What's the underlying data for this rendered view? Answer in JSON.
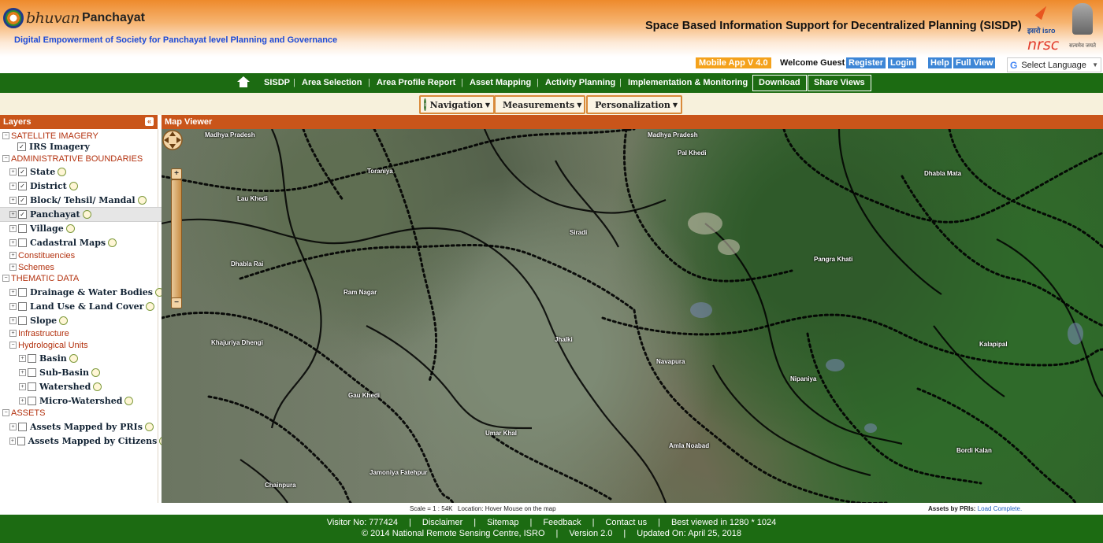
{
  "header": {
    "logo_word": "bhuvan",
    "logo_sub": "Panchayat",
    "tagline": "Digital Empowerment of Society for Panchayat level Planning and Governance",
    "title": "Space Based Information Support for Decentralized Planning (SISDP)",
    "isro_label": "इसरो isro",
    "nrsc_label": "nrsc",
    "emblem_text": "सत्यमेव जयते"
  },
  "topbar": {
    "mobile_app": "Mobile App V 4.0",
    "welcome": "Welcome Guest",
    "register": "Register",
    "login": "Login",
    "help": "Help",
    "full_view": "Full View",
    "language": "Select Language"
  },
  "nav": {
    "items": [
      "SISDP",
      "Area Selection",
      "Area Profile Report",
      "Asset Mapping",
      "Activity Planning",
      "Implementation & Monitoring"
    ],
    "download": "Download",
    "share_views": "Share Views"
  },
  "toolbar": {
    "navigation": "Navigation",
    "measurements": "Measurements",
    "personalization": "Personalization"
  },
  "layers": {
    "title": "Layers",
    "rows": {
      "satellite": "SATELLITE IMAGERY",
      "irs": "IRS Imagery",
      "admin": "ADMINISTRATIVE BOUNDARIES",
      "state": "State",
      "district": "District",
      "block": "Block/ Tehsil/ Mandal",
      "panchayat": "Panchayat",
      "village": "Village",
      "cadastral": "Cadastral Maps",
      "constituencies": "Constituencies",
      "schemes": "Schemes",
      "thematic": "THEMATIC DATA",
      "drainage": "Drainage & Water Bodies",
      "landuse": "Land Use & Land Cover",
      "slope": "Slope",
      "infrastructure": "Infrastructure",
      "hydro": "Hydrological Units",
      "basin": "Basin",
      "subbasin": "Sub-Basin",
      "watershed": "Watershed",
      "microwatershed": "Micro-Watershed",
      "assets": "ASSETS",
      "assets_pri": "Assets Mapped by PRIs",
      "assets_citizens": "Assets Mapped by Citizens"
    }
  },
  "map": {
    "title": "Map Viewer",
    "places": {
      "madhya1": "Madhya Pradesh",
      "madhya2": "Madhya Pradesh",
      "pal_khedi": "Pal Khedi",
      "toraniya": "Toraniya",
      "dhabla_mata": "Dhabla Mata",
      "lau_khedi": "Lau Khedi",
      "siradi": "Siradi",
      "pangra_khati": "Pangra Khati",
      "dhabla_rai": "Dhabla Rai",
      "ram_nagar": "Ram Nagar",
      "khajuriya": "Khajuriya Dhengi",
      "jhalki": "Jhalki",
      "kalapipal": "Kalapipal",
      "navapura": "Navapura",
      "nipaniya": "Nipaniya",
      "gau_khedi": "Gau Khedi",
      "umar_khal": "Umar Khal",
      "amla_noabad": "Amla Noabad",
      "bordi_kalan": "Bordi Kalan",
      "chainpura": "Chainpura",
      "jamoniya": "Jamoniya Fatehpur"
    }
  },
  "status": {
    "scale": "Scale = 1 : 54K",
    "location": "Location: Hover Mouse on the map",
    "assets_label": "Assets by PRIs:",
    "assets_value": "Load Complete."
  },
  "footer": {
    "visitor": "Visitor No: 777424",
    "disclaimer": "Disclaimer",
    "sitemap": "Sitemap",
    "feedback": "Feedback",
    "contact": "Contact us",
    "best_viewed": "Best viewed in 1280 * 1024",
    "copyright": "© 2014 National Remote Sensing Centre, ISRO",
    "version": "Version 2.0",
    "updated": "Updated On: April 25, 2018",
    "separator": "|"
  },
  "colors": {
    "nav_green": "#1c6b12",
    "panel_orange": "#c9551a",
    "link_blue": "#3d86d6",
    "badge_orange": "#f4a21c"
  }
}
